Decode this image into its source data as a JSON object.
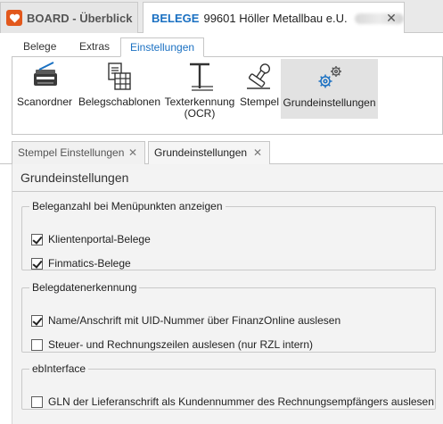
{
  "doc_tabs": {
    "board_label": "BOARD - Überblick",
    "belege_keyword": "BELEGE",
    "belege_title": "99601 Höller Metallbau e.U.",
    "close_glyph": "✕"
  },
  "ribbon_tabs": [
    {
      "label": "Belege"
    },
    {
      "label": "Extras"
    },
    {
      "label": "Einstellungen",
      "active": true
    }
  ],
  "ribbon_buttons": [
    {
      "label": "Scanordner",
      "icon": "scanner-icon"
    },
    {
      "label": "Belegschablonen",
      "icon": "template-icon"
    },
    {
      "label_line1": "Texterkennung",
      "label_line2": "(OCR)",
      "icon": "ocr-icon"
    },
    {
      "label": "Stempel",
      "icon": "stamp-icon"
    },
    {
      "label": "Grundeinstellungen",
      "icon": "gears-icon",
      "selected": true
    }
  ],
  "inner_tabs": [
    {
      "label": "Stempel Einstellungen",
      "close": "✕"
    },
    {
      "label": "Grundeinstellungen",
      "close": "✕",
      "active": true
    }
  ],
  "panel": {
    "title": "Grundeinstellungen",
    "groups": [
      {
        "legend": "Beleganzahl bei Menüpunkten anzeigen",
        "options": [
          {
            "label": "Klientenportal-Belege",
            "checked": true
          },
          {
            "label": "Finmatics-Belege",
            "checked": true
          }
        ]
      },
      {
        "legend": "Belegdatenerkennung",
        "options": [
          {
            "label": "Name/Anschrift mit UID-Nummer über FinanzOnline auslesen",
            "checked": true
          },
          {
            "label": "Steuer- und Rechnungszeilen auslesen (nur RZL intern)",
            "checked": false
          }
        ]
      },
      {
        "legend": "ebInterface",
        "options": [
          {
            "label": "GLN der Lieferanschrift als Kundennummer des Rechnungsempfängers auslesen",
            "checked": false
          }
        ]
      }
    ]
  },
  "colors": {
    "brand_orange": "#e2581c",
    "accent_blue": "#1a70c2",
    "selected_bg": "#e2e2e2"
  }
}
